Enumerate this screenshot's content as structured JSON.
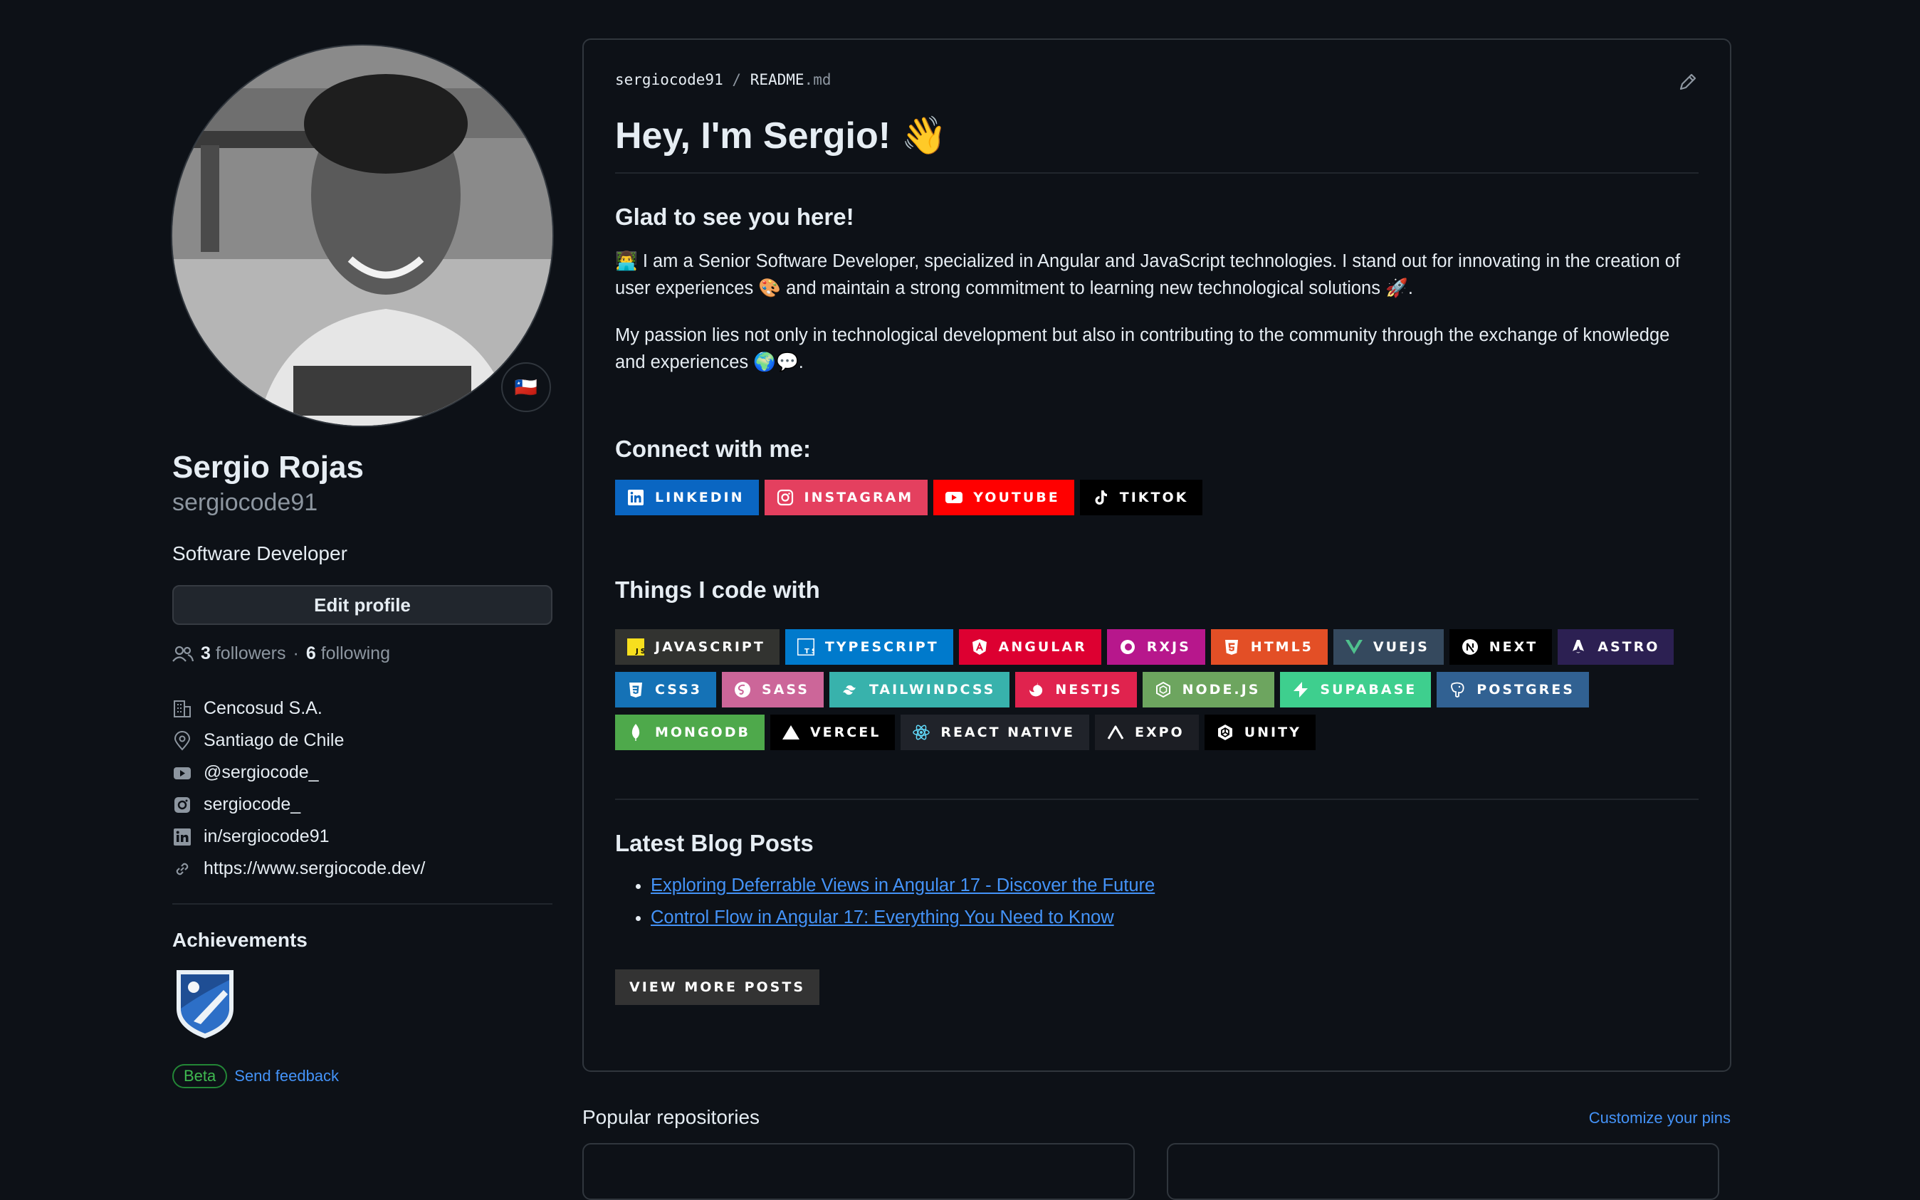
{
  "profile": {
    "name": "Sergio Rojas",
    "login": "sergiocode91",
    "bio": "Software Developer",
    "status_emoji": "🇨🇱",
    "edit_label": "Edit profile",
    "followers_count": "3",
    "followers_label": "followers",
    "following_count": "6",
    "following_label": "following",
    "separator": "·",
    "company": "Cencosud S.A.",
    "location": "Santiago de Chile",
    "youtube": "@sergiocode_",
    "instagram": "sergiocode_",
    "linkedin": "in/sergiocode91",
    "website": "https://www.sergiocode.dev/",
    "achievements_title": "Achievements",
    "beta_label": "Beta",
    "feedback_label": "Send feedback"
  },
  "readme": {
    "owner": "sergiocode91",
    "path_sep": "/",
    "file_name": "README",
    "file_ext": ".md",
    "heading": "Hey, I'm Sergio! 👋",
    "glad": "Glad to see you here!",
    "para1": "👨‍💻 I am a Senior Software Developer, specialized in Angular and JavaScript technologies. I stand out for innovating in the creation of user experiences 🎨 and maintain a strong commitment to learning new technological solutions 🚀.",
    "para2": "My passion lies not only in technological development but also in contributing to the community through the exchange of knowledge and experiences 🌍💬.",
    "connect_title": "Connect with me:",
    "social_badges": [
      {
        "label": "LINKEDIN",
        "color": "#0a66c2"
      },
      {
        "label": "INSTAGRAM",
        "color": "#e4405f"
      },
      {
        "label": "YOUTUBE",
        "color": "#ff0000"
      },
      {
        "label": "TIKTOK",
        "color": "#000000"
      }
    ],
    "tech_title": "Things I code with",
    "tech_badges": [
      {
        "label": "JAVASCRIPT",
        "color": "#323330"
      },
      {
        "label": "TYPESCRIPT",
        "color": "#007acc"
      },
      {
        "label": "ANGULAR",
        "color": "#dd0031"
      },
      {
        "label": "RXJS",
        "color": "#b7178c"
      },
      {
        "label": "HTML5",
        "color": "#e34f26"
      },
      {
        "label": "VUEJS",
        "color": "#35495e"
      },
      {
        "label": "NEXT",
        "color": "#000000"
      },
      {
        "label": "ASTRO",
        "color": "#2c2052"
      },
      {
        "label": "CSS3",
        "color": "#1572b6"
      },
      {
        "label": "SASS",
        "color": "#cc6699"
      },
      {
        "label": "TAILWINDCSS",
        "color": "#38b2ac"
      },
      {
        "label": "NESTJS",
        "color": "#e0234e"
      },
      {
        "label": "NODE.JS",
        "color": "#6da55f"
      },
      {
        "label": "SUPABASE",
        "color": "#3ecf8e"
      },
      {
        "label": "POSTGRES",
        "color": "#316192"
      },
      {
        "label": "MONGODB",
        "color": "#4ea94b"
      },
      {
        "label": "VERCEL",
        "color": "#000000"
      },
      {
        "label": "REACT NATIVE",
        "color": "#20232a"
      },
      {
        "label": "EXPO",
        "color": "#1c1e24"
      },
      {
        "label": "UNITY",
        "color": "#000000"
      }
    ],
    "blog_title": "Latest Blog Posts",
    "posts": [
      "Exploring Deferrable Views in Angular 17 - Discover the Future",
      "Control Flow in Angular 17: Everything You Need to Know"
    ],
    "view_more": "VIEW MORE POSTS"
  },
  "repos": {
    "title": "Popular repositories",
    "customize_label": "Customize your pins"
  }
}
